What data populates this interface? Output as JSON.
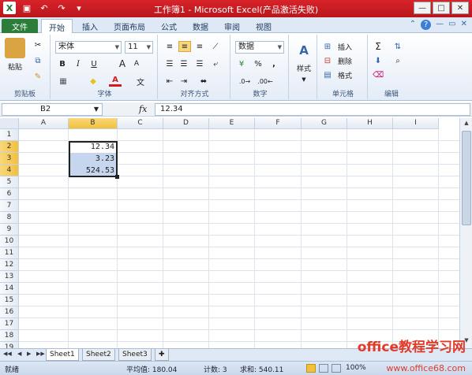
{
  "window": {
    "title": "工作簿1 - Microsoft Excel(产品激活失败)",
    "controls": [
      "—",
      "□",
      "✕"
    ]
  },
  "ribbon": {
    "tabs": [
      "文件",
      "开始",
      "插入",
      "页面布局",
      "公式",
      "数据",
      "审阅",
      "视图"
    ],
    "active_tab": "开始",
    "groups": {
      "clipboard": {
        "label": "剪贴板",
        "paste": "粘贴"
      },
      "font": {
        "label": "字体",
        "font_name": "宋体",
        "font_size": "11",
        "bold": "B",
        "italic": "I",
        "underline": "U",
        "grow": "A",
        "shrink": "A",
        "font_color": "A",
        "phonetic": "文"
      },
      "alignment": {
        "label": "对齐方式"
      },
      "number": {
        "label": "数字",
        "format": "数据",
        "percent": "%",
        "comma": ","
      },
      "styles": {
        "label": "样式"
      },
      "cells": {
        "label": "单元格",
        "insert": "插入",
        "delete": "删除",
        "format": "格式"
      },
      "editing": {
        "label": "编辑",
        "sum": "Σ"
      }
    }
  },
  "formula_bar": {
    "name_box": "B2",
    "fx": "fx",
    "formula": "12.34"
  },
  "sheet": {
    "columns": [
      "A",
      "B",
      "C",
      "D",
      "E",
      "F",
      "G",
      "H",
      "I"
    ],
    "selected_column": "B",
    "rows": [
      "1",
      "2",
      "3",
      "4",
      "5",
      "6",
      "7",
      "8",
      "9",
      "10",
      "11",
      "12",
      "13",
      "14",
      "15",
      "16",
      "17",
      "18",
      "19"
    ],
    "selected_rows": [
      "2",
      "3",
      "4"
    ],
    "cells": [
      {
        "ref": "B2",
        "value": "12.34"
      },
      {
        "ref": "B3",
        "value": "3.23"
      },
      {
        "ref": "B4",
        "value": "524.53"
      }
    ]
  },
  "sheet_tabs": [
    "Sheet1",
    "Sheet2",
    "Sheet3"
  ],
  "active_sheet": "Sheet1",
  "status": {
    "mode": "就绪",
    "average": "平均值: 180.04",
    "count": "计数: 3",
    "sum": "求和: 540.11",
    "zoom": "100%"
  },
  "watermark": {
    "title": "office教程学习网",
    "url": "www.office68.com"
  },
  "colors": {
    "title_red": "#d8232a",
    "file_tab_green": "#2d7d3a",
    "selection_header": "#f3c03c",
    "selection_fill": "#c6d6ee"
  }
}
